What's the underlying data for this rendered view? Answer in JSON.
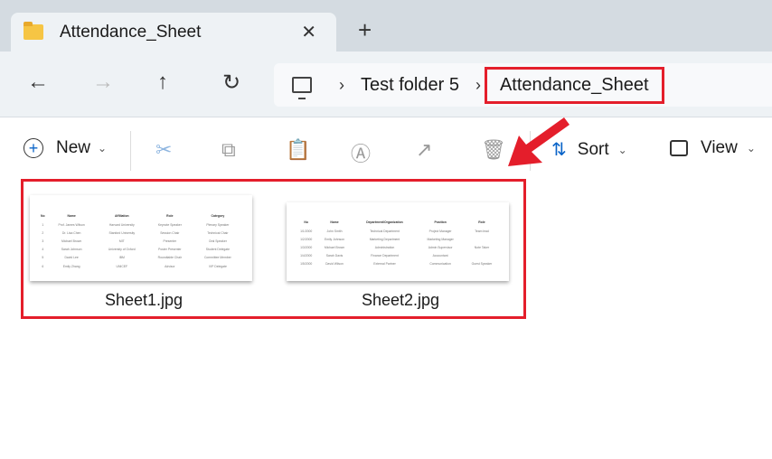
{
  "tab": {
    "title": "Attendance_Sheet",
    "close": "✕",
    "new_tab": "+"
  },
  "nav": {
    "back": "←",
    "forward": "→",
    "up": "↑",
    "refresh": "↻"
  },
  "breadcrumb": {
    "items": [
      "Test folder 5",
      "Attendance_Sheet"
    ],
    "separator": "›"
  },
  "toolbar": {
    "new_label": "New",
    "sort_label": "Sort",
    "view_label": "View",
    "chevron": "⌄"
  },
  "files": [
    {
      "name": "Sheet1.jpg",
      "headers": [
        "No",
        "Name",
        "Affiliation",
        "Role",
        "Category"
      ],
      "rows": [
        [
          "1",
          "Prof. James Wilson",
          "Harvard University",
          "Keynote Speaker",
          "Plenary Speaker"
        ],
        [
          "2",
          "Dr. Lisa Chen",
          "Stanford University",
          "Session Chair",
          "Technical Chair"
        ],
        [
          "3",
          "Michael Brown",
          "MIT",
          "Presenter",
          "Oral Speaker"
        ],
        [
          "4",
          "Sarah Johnson",
          "University of Oxford",
          "Poster Presenter",
          "Student Delegate"
        ],
        [
          "5",
          "David Lee",
          "IBM",
          "Roundtable Chair",
          "Committee Member"
        ],
        [
          "6",
          "Emily Zhang",
          "UNICEF",
          "Advisor",
          "VIP Delegate"
        ]
      ]
    },
    {
      "name": "Sheet2.jpg",
      "headers": [
        "No",
        "Name",
        "Department/Organization",
        "Position",
        "Role"
      ],
      "rows": [
        [
          "1/1/2000",
          "John Smith",
          "Technical Department",
          "Project Manager",
          "Team lead"
        ],
        [
          "1/2/2000",
          "Emily Johnson",
          "Marketing Department",
          "Marketing Manager",
          ""
        ],
        [
          "1/3/2000",
          "Michael Brown",
          "Administration",
          "Admin Supervisor",
          "Note Taker"
        ],
        [
          "1/4/2000",
          "Sarah Davis",
          "Finance Department",
          "Accountant",
          ""
        ],
        [
          "1/5/2000",
          "David Wilson",
          "External Partner",
          "Communication",
          "Guest Speaker"
        ]
      ]
    }
  ]
}
